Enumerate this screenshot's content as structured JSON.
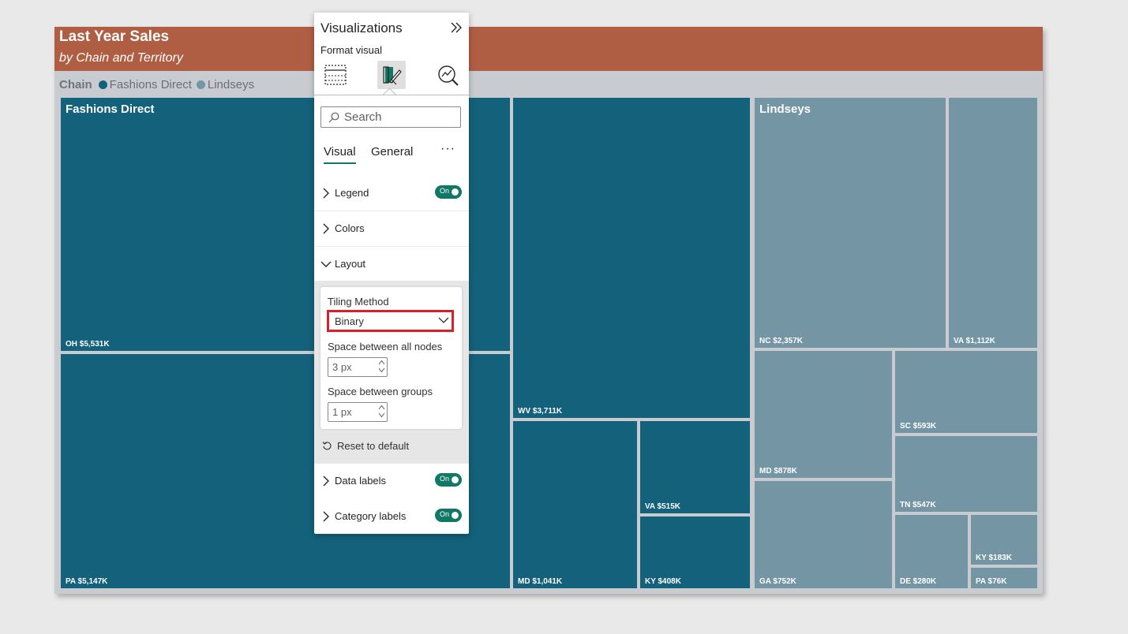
{
  "report": {
    "title": "Last Year Sales",
    "subtitle": "by Chain and Territory",
    "legend": {
      "title": "Chain",
      "items": [
        {
          "label": "Fashions Direct",
          "color": "#13617b"
        },
        {
          "label": "Lindseys",
          "color": "#7395a4"
        }
      ]
    }
  },
  "chart_data": {
    "type": "treemap",
    "title": "Last Year Sales",
    "subtitle": "by Chain and Territory",
    "legend_title": "Chain",
    "groups": [
      {
        "name": "Fashions Direct",
        "color": "#13617b",
        "items": [
          {
            "territory": "OH",
            "value_k": 5531,
            "label": "OH $5,531K"
          },
          {
            "territory": "PA",
            "value_k": 5147,
            "label": "PA $5,147K"
          },
          {
            "territory": "WV",
            "value_k": 3711,
            "label": "WV $3,711K"
          },
          {
            "territory": "MD",
            "value_k": 1041,
            "label": "MD $1,041K"
          },
          {
            "territory": "VA",
            "value_k": 515,
            "label": "VA $515K"
          },
          {
            "territory": "KY",
            "value_k": 408,
            "label": "KY $408K"
          }
        ]
      },
      {
        "name": "Lindseys",
        "color": "#7395a4",
        "items": [
          {
            "territory": "NC",
            "value_k": 2357,
            "label": "NC $2,357K"
          },
          {
            "territory": "VA",
            "value_k": 1112,
            "label": "VA $1,112K"
          },
          {
            "territory": "MD",
            "value_k": 878,
            "label": "MD $878K"
          },
          {
            "territory": "GA",
            "value_k": 752,
            "label": "GA $752K"
          },
          {
            "territory": "SC",
            "value_k": 593,
            "label": "SC $593K"
          },
          {
            "territory": "TN",
            "value_k": 547,
            "label": "TN $547K"
          },
          {
            "territory": "DE",
            "value_k": 280,
            "label": "DE $280K"
          },
          {
            "territory": "KY",
            "value_k": 183,
            "label": "KY $183K"
          },
          {
            "territory": "PA",
            "value_k": 76,
            "label": "PA $76K"
          }
        ]
      }
    ]
  },
  "pane": {
    "title": "Visualizations",
    "subtitle": "Format visual",
    "icons": [
      "build-visual-icon",
      "format-visual-icon",
      "analytics-icon"
    ],
    "search_placeholder": "Search",
    "tabs": [
      "Visual",
      "General"
    ],
    "more_label": "···",
    "sections": {
      "legend": {
        "label": "Legend",
        "toggle": "On"
      },
      "colors": {
        "label": "Colors"
      },
      "layout": {
        "label": "Layout"
      },
      "data_labels": {
        "label": "Data labels",
        "toggle": "On"
      },
      "category_labels": {
        "label": "Category labels",
        "toggle": "On"
      }
    },
    "layout": {
      "tiling_label": "Tiling Method",
      "tiling_value": "Binary",
      "space_nodes_label": "Space between all nodes",
      "space_nodes_value": "3 px",
      "space_groups_label": "Space between groups",
      "space_groups_value": "1 px",
      "reset_label": "Reset to default"
    }
  }
}
